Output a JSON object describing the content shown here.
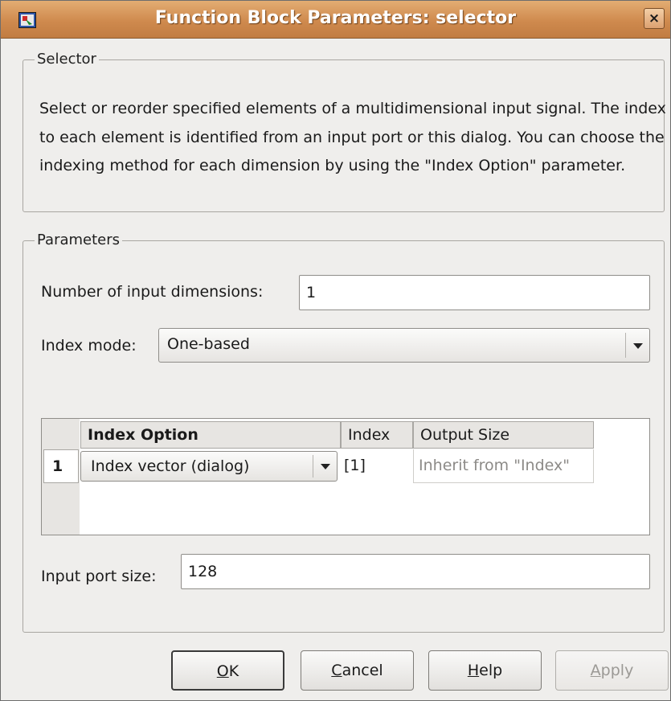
{
  "window": {
    "title": "Function Block Parameters: selector",
    "close_glyph": "×"
  },
  "selector_group": {
    "legend": "Selector",
    "description": "Select or reorder specified elements of a multidimensional input signal. The index to each element is identified from an input port or this dialog. You can choose the indexing method for each dimension by using the \"Index Option\" parameter."
  },
  "parameters_group": {
    "legend": "Parameters",
    "num_dims_label": "Number of input dimensions:",
    "num_dims_value": "1",
    "index_mode_label": "Index mode:",
    "index_mode_value": "One-based",
    "table": {
      "columns": [
        "Index Option",
        "Index",
        "Output Size"
      ],
      "rows": [
        {
          "row_number": "1",
          "index_option": "Index vector (dialog)",
          "index": "[1]",
          "output_size": "Inherit from \"Index\""
        }
      ]
    },
    "input_port_size_label": "Input port size:",
    "input_port_size_value": "128"
  },
  "buttons": {
    "ok": {
      "mnemonic": "O",
      "rest": "K"
    },
    "cancel": {
      "mnemonic": "C",
      "rest": "ancel"
    },
    "help": {
      "mnemonic": "H",
      "rest": "elp"
    },
    "apply": {
      "mnemonic": "A",
      "rest": "pply"
    }
  },
  "colors": {
    "titlebar": "#cf8a4e",
    "background": "#efeeec"
  },
  "icons": {
    "app": "simulink-block-icon",
    "close": "close-icon",
    "dropdown": "chevron-down-icon"
  }
}
